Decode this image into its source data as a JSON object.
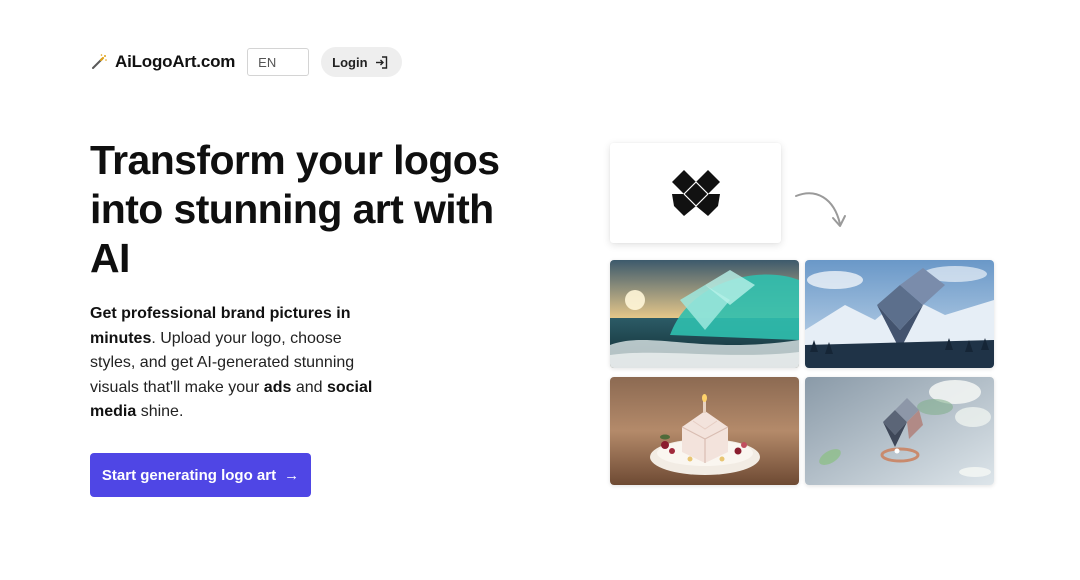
{
  "header": {
    "brand_name": "AiLogoArt.com",
    "brand_icon": "magic-wand-icon",
    "language": "EN",
    "login_label": "Login",
    "login_icon": "login-arrow-icon"
  },
  "hero": {
    "headline": "Transform your logos into stunning art with AI",
    "sub": {
      "bold_1": "Get professional brand pictures in minutes",
      "text_1": ". Upload your logo, choose styles, and get AI-generated stunning visuals that'll make your ",
      "bold_2": "ads",
      "text_2": " and ",
      "bold_3": "social media",
      "text_3": " shine."
    },
    "cta_label": "Start generating logo art",
    "cta_arrow": "→"
  },
  "showcase": {
    "source_logo": "black-geometric-logo",
    "arrow_icon": "curved-arrow-icon",
    "images": [
      "ocean-wave-logo-art",
      "snowy-mountain-logo-art",
      "cake-logo-art",
      "crystal-ring-logo-art"
    ]
  },
  "colors": {
    "cta_background": "#4f46e5",
    "login_background": "#eeeeee"
  }
}
